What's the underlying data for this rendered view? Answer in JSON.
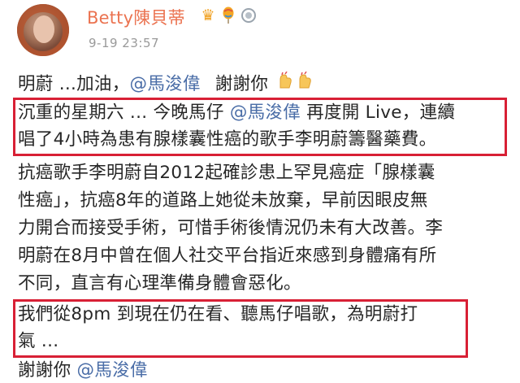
{
  "post": {
    "author": "Betty陳貝蒂",
    "timestamp": "9-19 23:57",
    "badges": [
      "crown-badge-icon",
      "balloon-badge-icon",
      "medal-badge-icon"
    ],
    "colors": {
      "author": "#eb7350",
      "mention": "#4a6da7",
      "highlight_box": "#d82035",
      "timestamp": "#9a9a9a"
    },
    "line1": {
      "prefix": "明蔚 ...加油，",
      "mention": "@馬浚偉",
      "suffix": "謝謝你"
    },
    "box1": {
      "line_a_prefix": "沉重的星期六 ... 今晚馬仔 ",
      "line_a_mention": "@馬浚偉",
      "line_a_suffix": " 再度開 Live，連續",
      "line_b": "唱了4小時為患有腺樣囊性癌的歌手李明蔚籌醫藥費。"
    },
    "body_lines": [
      "抗癌歌手李明蔚自2012起確診患上罕見癌症「腺樣囊",
      "性癌」，抗癌8年的道路上她從未放棄，早前因眼皮無",
      "力開合而接受手術，可惜手術後情況仍未有大改善。李",
      "明蔚在8月中曾在個人社交平台指近來感到身體痛有所",
      "不同，直言有心理準備身體會惡化。"
    ],
    "box2": {
      "line_a": "我們從8pm 到現在仍在看、聽馬仔唱歌，為明蔚打",
      "line_b": "氣 ..."
    },
    "last_line": {
      "prefix": "謝謝你 ",
      "mention": "@馬浚偉"
    }
  }
}
